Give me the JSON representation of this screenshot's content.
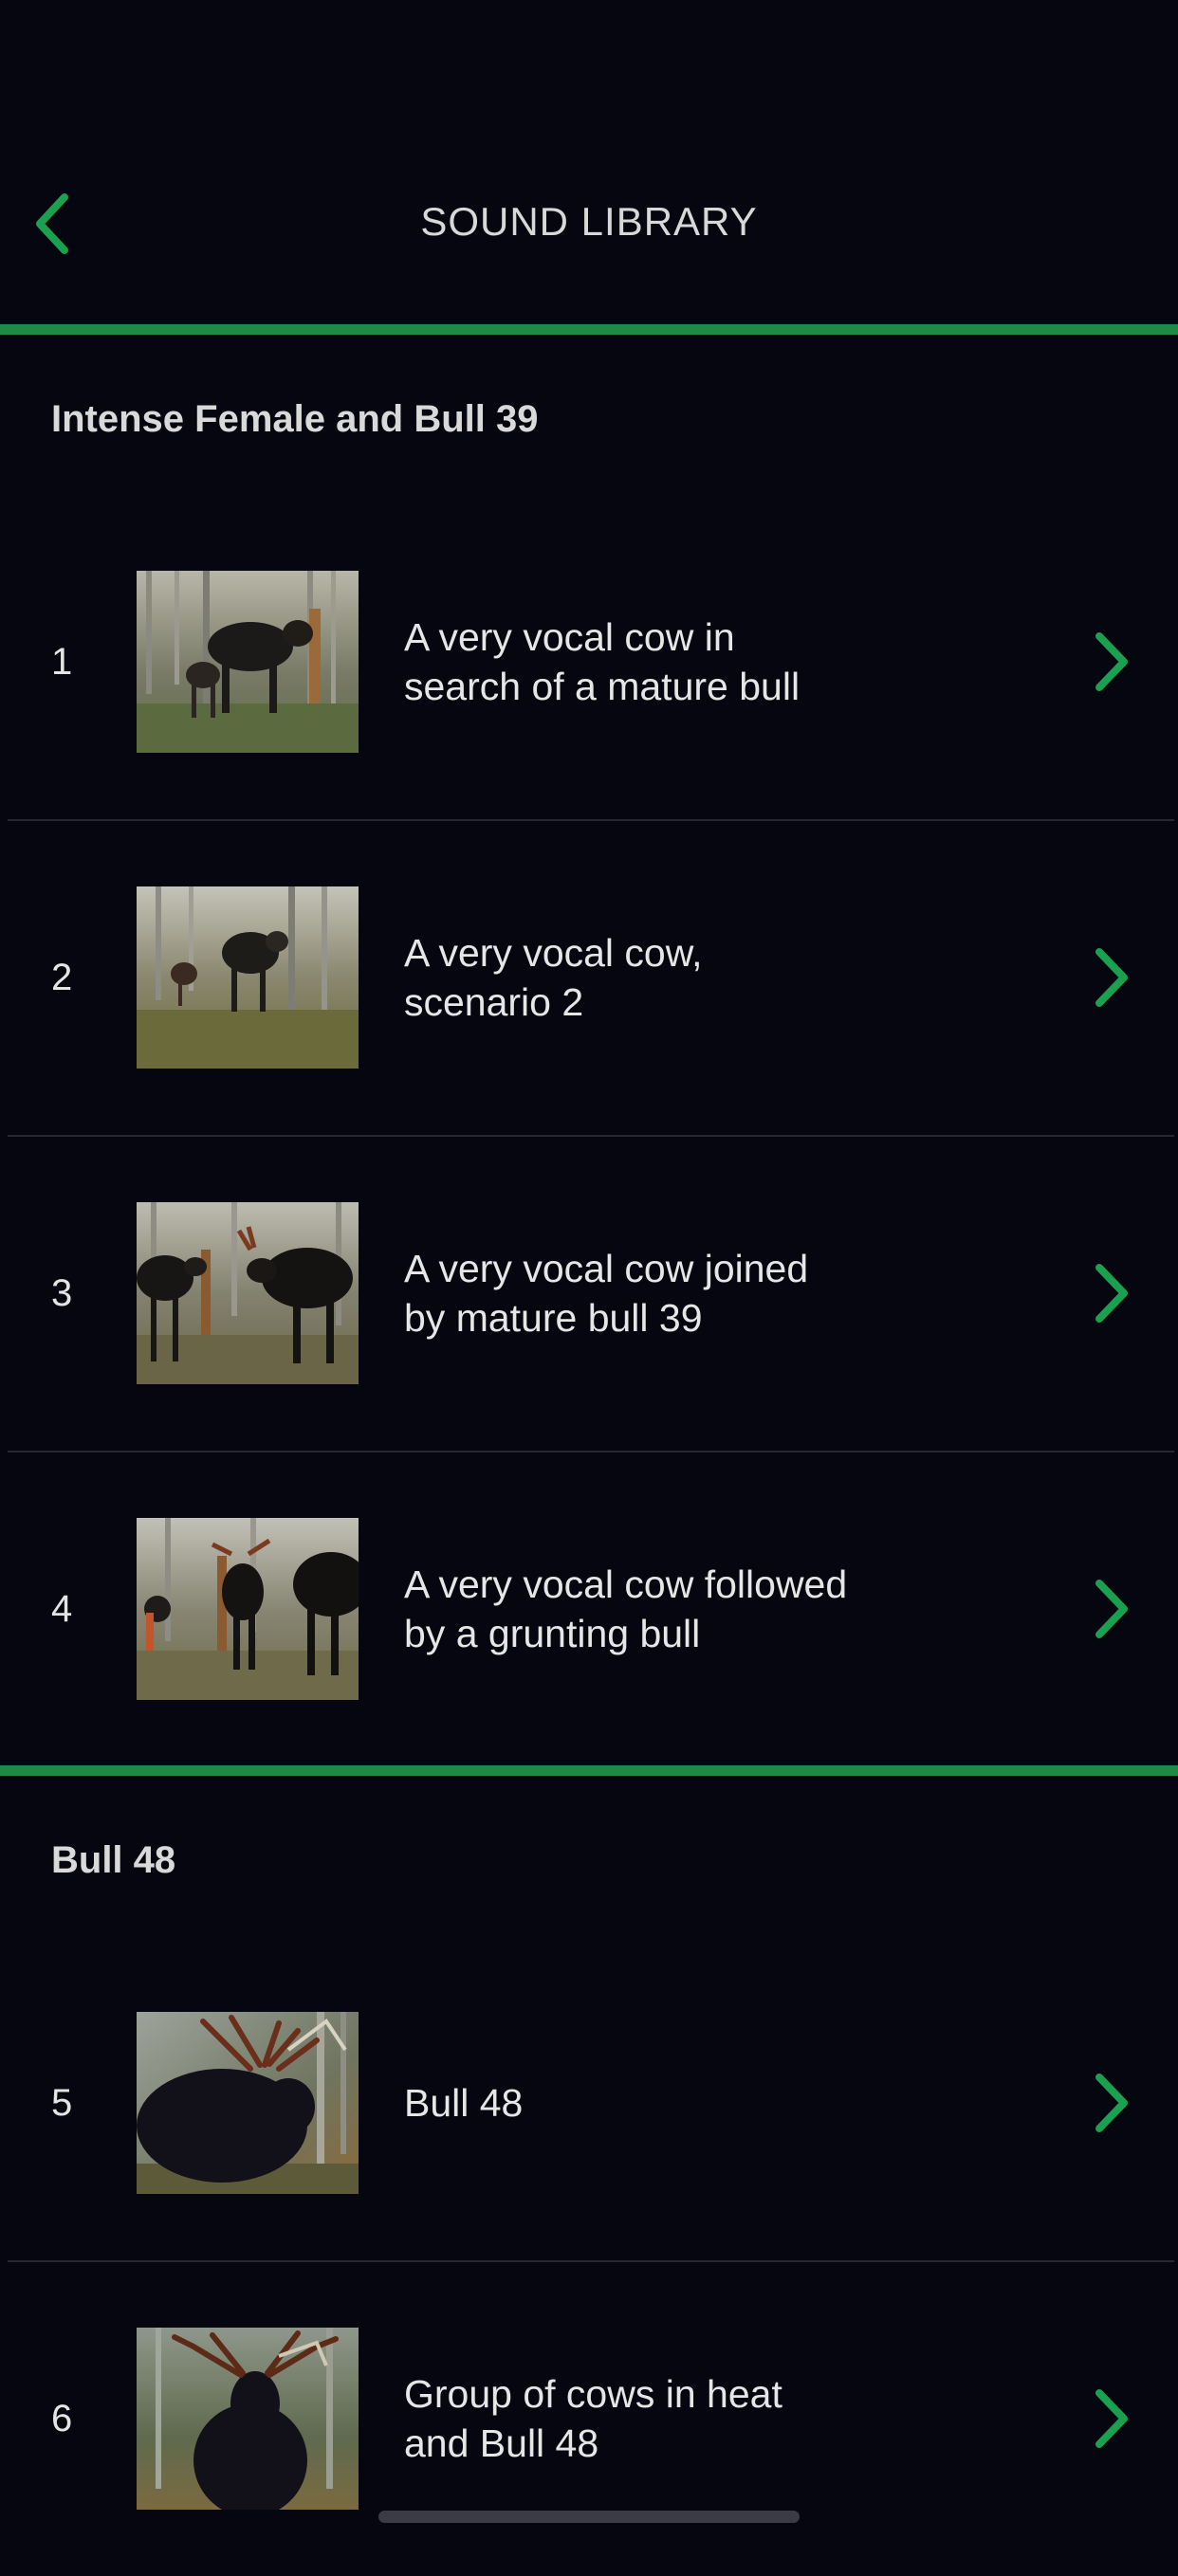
{
  "header": {
    "title": "SOUND LIBRARY"
  },
  "accent_color": "#1f8a45",
  "chevron_color": "#1aa150",
  "sections": [
    {
      "title": "Intense Female and Bull 39",
      "items": [
        {
          "num": "1",
          "label": "A very vocal cow in search of a mature bull",
          "thumb": "moose-cow-calf-photo"
        },
        {
          "num": "2",
          "label": "A very vocal cow, scenario 2",
          "thumb": "moose-cow-forest-photo"
        },
        {
          "num": "3",
          "label": "A very vocal cow joined by mature bull 39",
          "thumb": "moose-cow-bull-photo"
        },
        {
          "num": "4",
          "label": "A very vocal cow followed by a grunting bull",
          "thumb": "moose-group-photo"
        }
      ]
    },
    {
      "title": "Bull 48",
      "items": [
        {
          "num": "5",
          "label": "Bull 48",
          "thumb": "bull-moose-antlers-photo"
        },
        {
          "num": "6",
          "label": "Group of cows in heat and Bull 48",
          "thumb": "bull-moose-front-photo"
        }
      ]
    }
  ]
}
